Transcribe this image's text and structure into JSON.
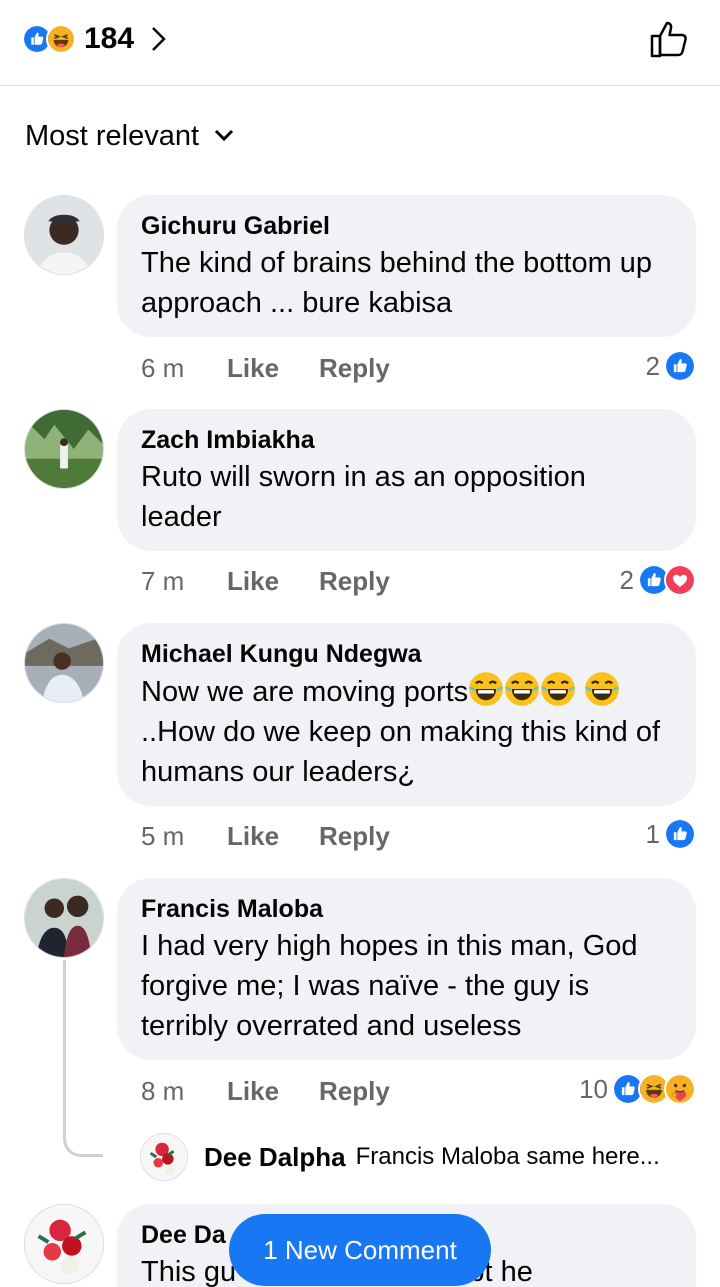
{
  "header": {
    "reaction_count": "184",
    "reaction_icons": [
      "like-icon",
      "haha-icon"
    ]
  },
  "sort": {
    "label": "Most relevant"
  },
  "comments": [
    {
      "author": "Gichuru Gabriel",
      "text": "The kind of brains behind the bottom up approach ... bure kabisa",
      "time": "6 m",
      "like_label": "Like",
      "reply_label": "Reply",
      "reaction_count": "2",
      "reactions": [
        "like-icon"
      ]
    },
    {
      "author": "Zach Imbiakha",
      "text": "Ruto will sworn in as an opposition leader",
      "time": "7 m",
      "like_label": "Like",
      "reply_label": "Reply",
      "reaction_count": "2",
      "reactions": [
        "like-icon",
        "love-icon"
      ]
    },
    {
      "author": "Michael Kungu Ndegwa",
      "text_part1": "Now we are moving ports",
      "text_part2": "..How do we keep on making this kind of humans our leaders¿",
      "time": "5 m",
      "like_label": "Like",
      "reply_label": "Reply",
      "reaction_count": "1",
      "reactions": [
        "like-icon"
      ]
    },
    {
      "author": "Francis Maloba",
      "text": "I had very high hopes in this man, God forgive me; I was naïve - the guy is terribly overrated and useless",
      "time": "8 m",
      "like_label": "Like",
      "reply_label": "Reply",
      "reaction_count": "10",
      "reactions": [
        "like-icon",
        "haha-icon",
        "care-icon"
      ],
      "reply_preview": {
        "author": "Dee Dalpha",
        "snippet": "Francis Maloba same here..."
      }
    },
    {
      "author": "Dee Da",
      "text": "This gu",
      "text_tail": "m bt he"
    }
  ],
  "toast": {
    "label": "1 New Comment"
  },
  "colors": {
    "accent": "#1877f2",
    "bubble": "#f0f2f5",
    "muted": "#65676b",
    "love": "#f33e58",
    "haha": "#f7b125"
  }
}
